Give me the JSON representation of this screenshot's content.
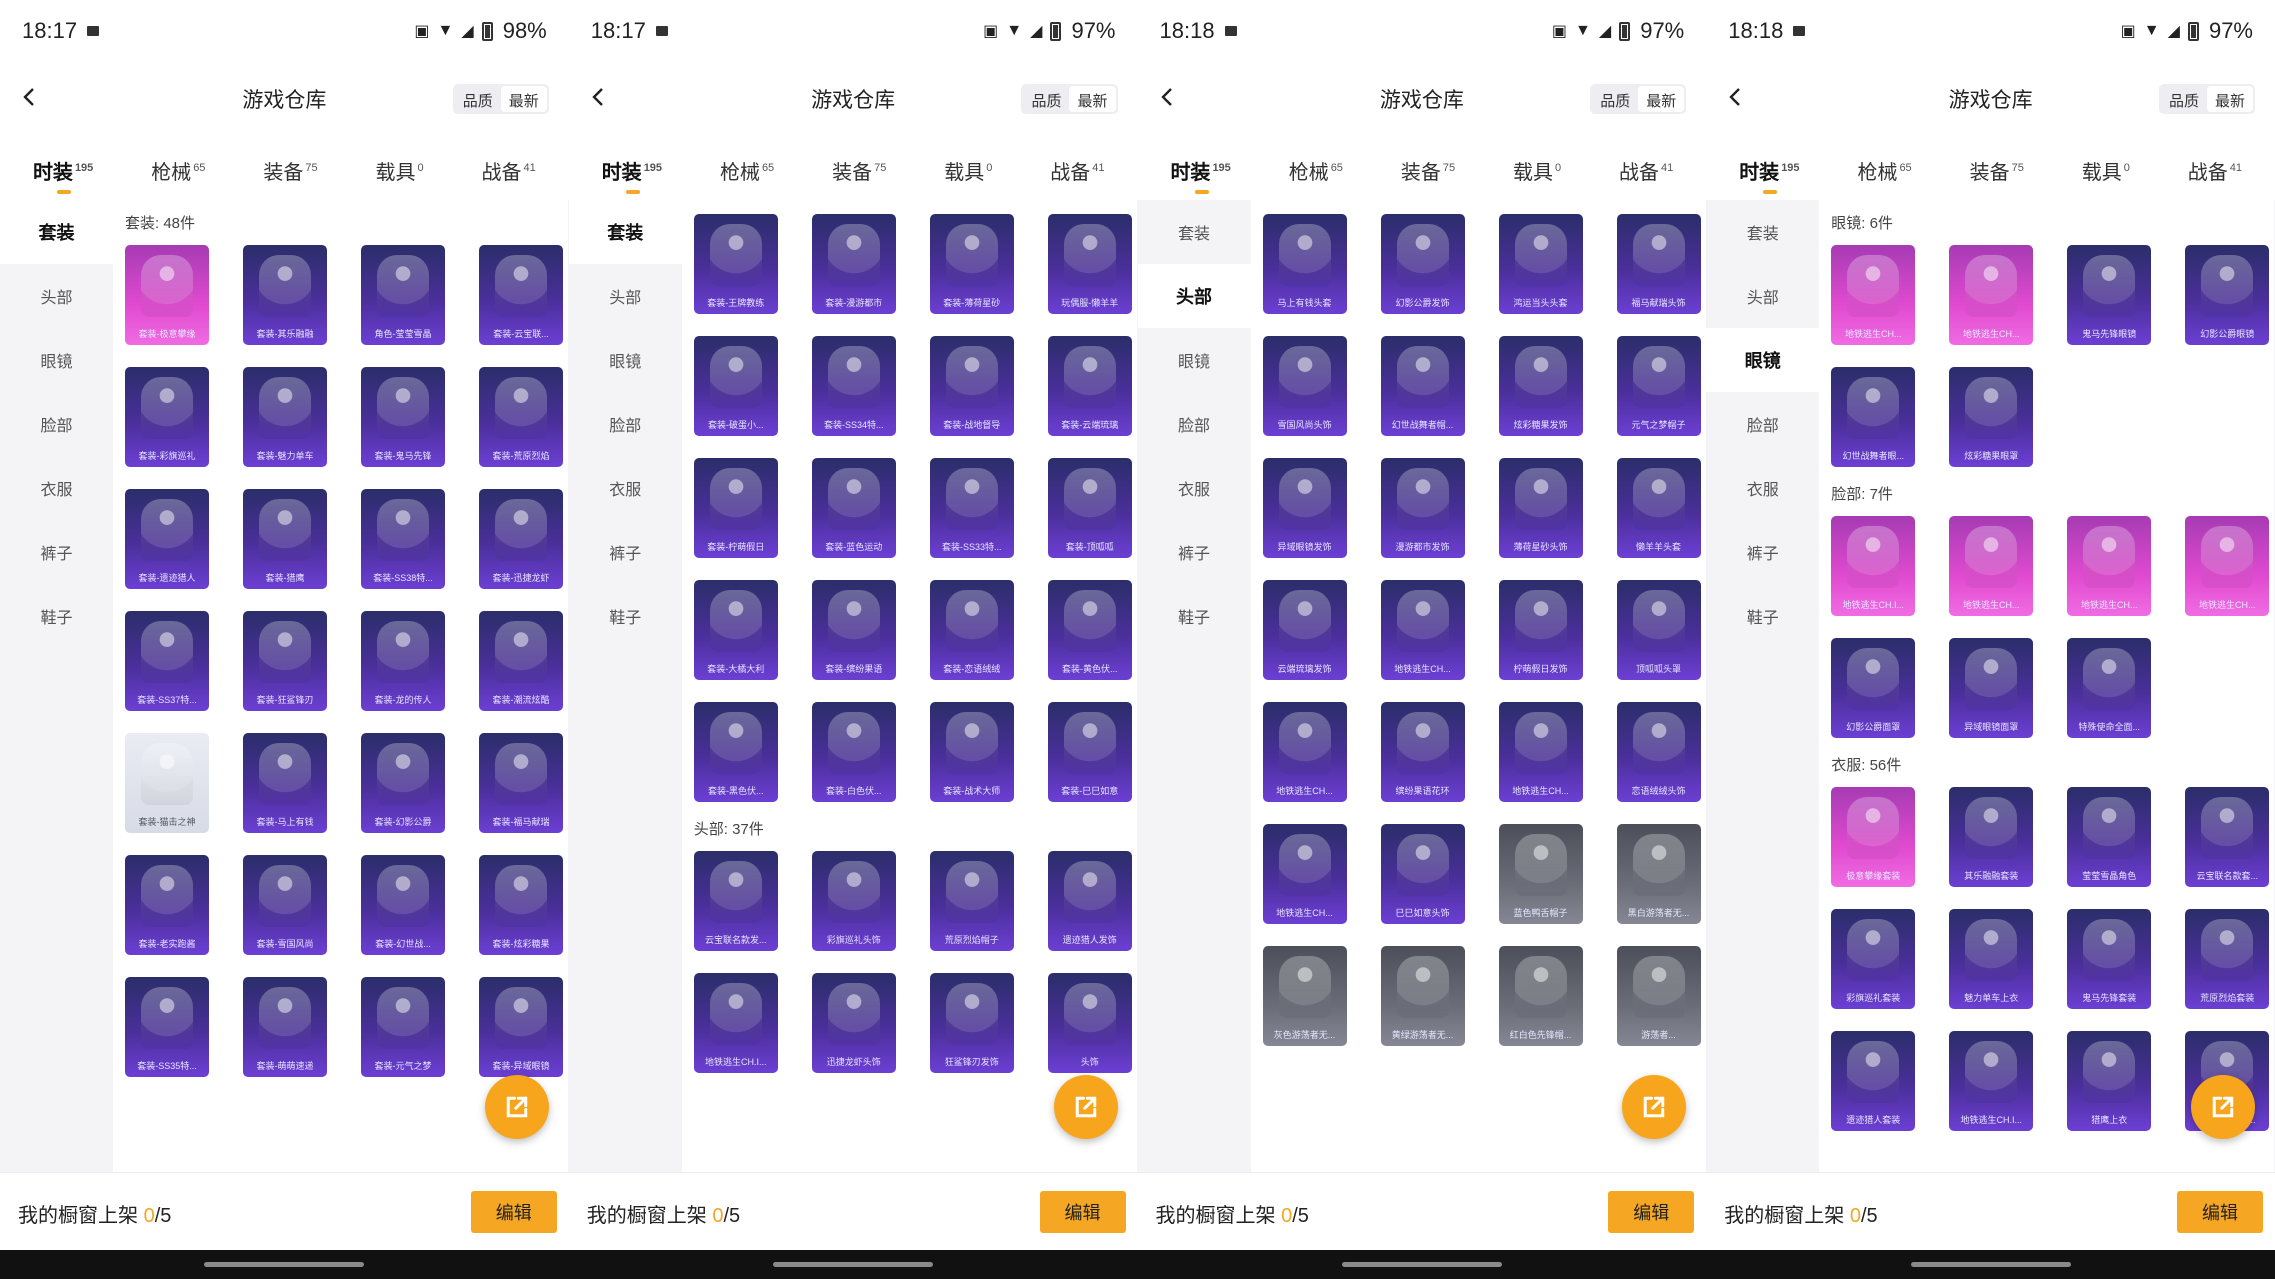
{
  "common": {
    "title": "游戏仓库",
    "back_icon": "chevron-left-icon",
    "sort": {
      "quality": "品质",
      "latest": "最新"
    },
    "tabs": [
      {
        "label": "时装",
        "count": "195"
      },
      {
        "label": "枪械",
        "count": "65"
      },
      {
        "label": "装备",
        "count": "75"
      },
      {
        "label": "载具",
        "count": "0"
      },
      {
        "label": "战备",
        "count": "41"
      }
    ],
    "sidebar": [
      "套装",
      "头部",
      "眼镜",
      "脸部",
      "衣服",
      "裤子",
      "鞋子"
    ],
    "bottom": {
      "label": "我的橱窗上架 ",
      "count": "0",
      "total": "/5",
      "edit": "编辑"
    },
    "fab_icon": "share-external-icon"
  },
  "screens": [
    {
      "time": "18:17",
      "battery": "98%",
      "active_tab": 0,
      "active_side": 0,
      "sections": [
        {
          "title": "套装: 48件",
          "items": [
            {
              "label": "套装-极意攀缘",
              "style": "pink"
            },
            {
              "label": "套装-其乐融融",
              "style": "purple"
            },
            {
              "label": "角色-莹莹雪晶",
              "style": "purple"
            },
            {
              "label": "套装-云宝联...",
              "style": "purple"
            },
            {
              "label": "套装-彩旗巡礼",
              "style": "purple"
            },
            {
              "label": "套装-魅力单车",
              "style": "purple"
            },
            {
              "label": "套装-鬼马先锋",
              "style": "purple"
            },
            {
              "label": "套装-荒原烈焰",
              "style": "purple"
            },
            {
              "label": "套装-遗迹猎人",
              "style": "purple"
            },
            {
              "label": "套装-猎鹰",
              "style": "purple"
            },
            {
              "label": "套装-SS38特...",
              "style": "purple"
            },
            {
              "label": "套装-迅捷龙虾",
              "style": "purple"
            },
            {
              "label": "套装-SS37特...",
              "style": "purple"
            },
            {
              "label": "套装-狂鲨锋刃",
              "style": "purple"
            },
            {
              "label": "套装-龙的传人",
              "style": "purple"
            },
            {
              "label": "套装-潮流炫酷",
              "style": "purple"
            },
            {
              "label": "套装-猫击之神",
              "style": "white"
            },
            {
              "label": "套装-马上有钱",
              "style": "purple"
            },
            {
              "label": "套装-幻影公爵",
              "style": "purple"
            },
            {
              "label": "套装-福马献瑞",
              "style": "purple"
            },
            {
              "label": "套装-老实跑酱",
              "style": "purple"
            },
            {
              "label": "套装-雪国风尚",
              "style": "purple"
            },
            {
              "label": "套装-幻世战...",
              "style": "purple"
            },
            {
              "label": "套装-炫彩糖果",
              "style": "purple"
            },
            {
              "label": "套装-SS35特...",
              "style": "purple"
            },
            {
              "label": "套装-萌萌速递",
              "style": "purple"
            },
            {
              "label": "套装-元气之梦",
              "style": "purple"
            },
            {
              "label": "套装-异域眼镜",
              "style": "purple"
            }
          ]
        }
      ]
    },
    {
      "time": "18:17",
      "battery": "97%",
      "active_tab": 0,
      "active_side": 0,
      "sections": [
        {
          "title": "",
          "items": [
            {
              "label": "套装-王牌教练",
              "style": "purple"
            },
            {
              "label": "套装-漫游都市",
              "style": "purple"
            },
            {
              "label": "套装-薄荷星砂",
              "style": "purple"
            },
            {
              "label": "玩偶服-懒羊羊",
              "style": "purple"
            },
            {
              "label": "套装-破蛋小...",
              "style": "purple"
            },
            {
              "label": "套装-SS34特...",
              "style": "purple"
            },
            {
              "label": "套装-战地督导",
              "style": "purple"
            },
            {
              "label": "套装-云端琉璃",
              "style": "purple"
            },
            {
              "label": "套装-柠萌假日",
              "style": "purple"
            },
            {
              "label": "套装-蓝色运动",
              "style": "purple"
            },
            {
              "label": "套装-SS33特...",
              "style": "purple"
            },
            {
              "label": "套装-顶呱呱",
              "style": "purple"
            },
            {
              "label": "套装-大橘大利",
              "style": "purple"
            },
            {
              "label": "套装-缤纷果语",
              "style": "purple"
            },
            {
              "label": "套装-恋语绒绒",
              "style": "purple"
            },
            {
              "label": "套装-黄色伏...",
              "style": "purple"
            },
            {
              "label": "套装-黑色伏...",
              "style": "purple"
            },
            {
              "label": "套装-白色伏...",
              "style": "purple"
            },
            {
              "label": "套装-战术大师",
              "style": "purple"
            },
            {
              "label": "套装-巳巳如意",
              "style": "purple"
            }
          ]
        },
        {
          "title": "头部: 37件",
          "items": [
            {
              "label": "云宝联名款发...",
              "style": "purple"
            },
            {
              "label": "彩旗巡礼头饰",
              "style": "purple"
            },
            {
              "label": "荒原烈焰帽子",
              "style": "purple"
            },
            {
              "label": "遗迹猎人发饰",
              "style": "purple"
            },
            {
              "label": "地铁逃生CH.I...",
              "style": "purple"
            },
            {
              "label": "迅捷龙虾头饰",
              "style": "purple"
            },
            {
              "label": "狂鲨锋刃发饰",
              "style": "purple"
            },
            {
              "label": "头饰",
              "style": "purple"
            }
          ]
        }
      ]
    },
    {
      "time": "18:18",
      "battery": "97%",
      "active_tab": 0,
      "active_side": 1,
      "sections": [
        {
          "title": "",
          "items": [
            {
              "label": "马上有钱头套",
              "style": "purple"
            },
            {
              "label": "幻影公爵发饰",
              "style": "purple"
            },
            {
              "label": "鸿运当头头套",
              "style": "purple"
            },
            {
              "label": "福马献瑞头饰",
              "style": "purple"
            },
            {
              "label": "雪国风尚头饰",
              "style": "purple"
            },
            {
              "label": "幻世战舞者帽...",
              "style": "purple"
            },
            {
              "label": "炫彩糖果发饰",
              "style": "purple"
            },
            {
              "label": "元气之梦帽子",
              "style": "purple"
            },
            {
              "label": "异域眼镜发饰",
              "style": "purple"
            },
            {
              "label": "漫游都市发饰",
              "style": "purple"
            },
            {
              "label": "薄荷星砂头饰",
              "style": "purple"
            },
            {
              "label": "懒羊羊头套",
              "style": "purple"
            },
            {
              "label": "云端琉璃发饰",
              "style": "purple"
            },
            {
              "label": "地铁逃生CH...",
              "style": "purple"
            },
            {
              "label": "柠萌假日发饰",
              "style": "purple"
            },
            {
              "label": "顶呱呱头罩",
              "style": "purple"
            },
            {
              "label": "地铁逃生CH...",
              "style": "purple"
            },
            {
              "label": "缤纷果语花环",
              "style": "purple"
            },
            {
              "label": "地铁逃生CH...",
              "style": "purple"
            },
            {
              "label": "恋语绒绒头饰",
              "style": "purple"
            },
            {
              "label": "地铁逃生CH...",
              "style": "purple"
            },
            {
              "label": "巳巳如意头饰",
              "style": "purple"
            },
            {
              "label": "蓝色鸭舌帽子",
              "style": "grey"
            },
            {
              "label": "黑白游荡者无...",
              "style": "grey"
            },
            {
              "label": "灰色游荡者无...",
              "style": "grey"
            },
            {
              "label": "黄绿游荡者无...",
              "style": "grey"
            },
            {
              "label": "红白色先锋帽...",
              "style": "grey"
            },
            {
              "label": "游荡者...",
              "style": "grey"
            }
          ]
        }
      ]
    },
    {
      "time": "18:18",
      "battery": "97%",
      "active_tab": 0,
      "active_side": 2,
      "sections": [
        {
          "title": "眼镜: 6件",
          "items": [
            {
              "label": "地铁逃生CH...",
              "style": "pink"
            },
            {
              "label": "地铁逃生CH...",
              "style": "pink"
            },
            {
              "label": "鬼马先锋眼镜",
              "style": "purple"
            },
            {
              "label": "幻影公爵眼镜",
              "style": "purple"
            },
            {
              "label": "幻世战舞者眼...",
              "style": "purple"
            },
            {
              "label": "炫彩糖果眼罩",
              "style": "purple"
            }
          ]
        },
        {
          "title": "脸部: 7件",
          "items": [
            {
              "label": "地铁逃生CH.I...",
              "style": "pink"
            },
            {
              "label": "地铁逃生CH...",
              "style": "pink"
            },
            {
              "label": "地铁逃生CH...",
              "style": "pink"
            },
            {
              "label": "地铁逃生CH...",
              "style": "pink"
            },
            {
              "label": "幻影公爵面罩",
              "style": "purple"
            },
            {
              "label": "异域眼镜面罩",
              "style": "purple"
            },
            {
              "label": "特殊使命全面...",
              "style": "purple"
            }
          ]
        },
        {
          "title": "衣服: 56件",
          "items": [
            {
              "label": "极意攀缘套装",
              "style": "pink"
            },
            {
              "label": "其乐融融套装",
              "style": "purple"
            },
            {
              "label": "莹莹雪晶角色",
              "style": "purple"
            },
            {
              "label": "云宝联名款套...",
              "style": "purple"
            },
            {
              "label": "彩旗巡礼套装",
              "style": "purple"
            },
            {
              "label": "魅力单车上衣",
              "style": "purple"
            },
            {
              "label": "鬼马先锋套装",
              "style": "purple"
            },
            {
              "label": "荒原烈焰套装",
              "style": "purple"
            },
            {
              "label": "遗迹猎人套装",
              "style": "purple"
            },
            {
              "label": "地铁逃生CH.I...",
              "style": "purple"
            },
            {
              "label": "猎鹰上衣",
              "style": "purple"
            },
            {
              "label": "SS38特训套...",
              "style": "purple"
            }
          ]
        }
      ]
    }
  ]
}
